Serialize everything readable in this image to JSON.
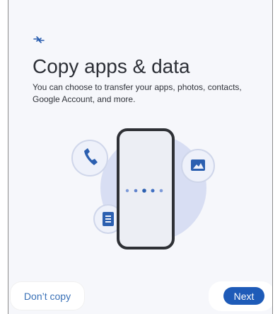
{
  "screen": {
    "title": "Copy apps & data",
    "subtitle": "You can choose to transfer your apps, photos, contacts, Google Account, and more.",
    "icons": {
      "header": "transfer-arrows-icon",
      "left_bubble": "phone-icon",
      "right_bubble": "image-icon",
      "bottom_bubble": "document-icon"
    },
    "progress_dots": 5,
    "active_dot": 3
  },
  "actions": {
    "secondary_label": "Don’t copy",
    "primary_label": "Next"
  },
  "colors": {
    "accent": "#1e5bb8",
    "secondary_text": "#3a71b7",
    "background": "#f6f7fb"
  }
}
